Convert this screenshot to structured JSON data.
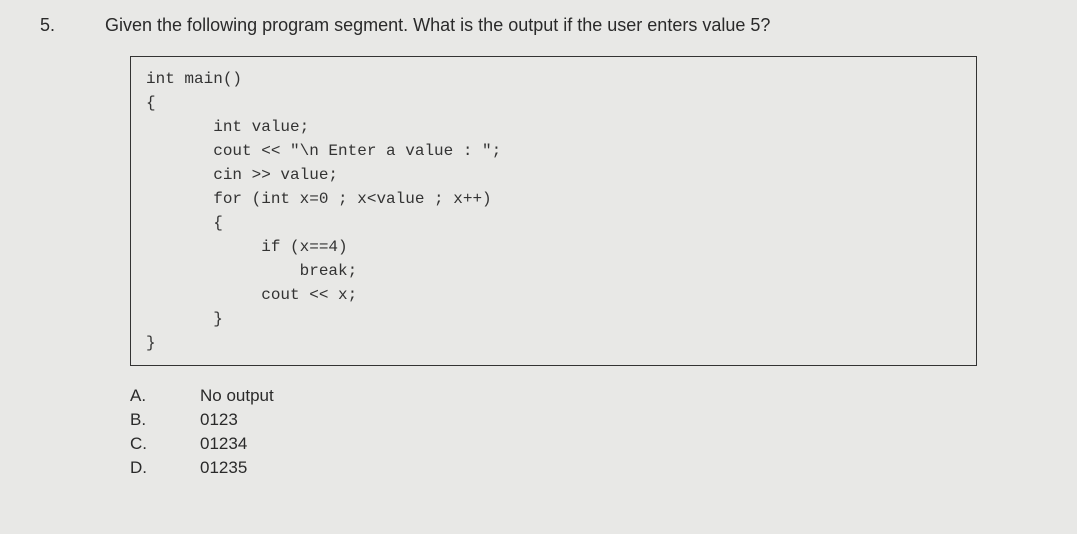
{
  "question": {
    "number": "5.",
    "text": "Given the following program segment. What is the output if the user enters value 5?"
  },
  "code": "int main()\n{\n       int value;\n       cout << \"\\n Enter a value : \";\n       cin >> value;\n       for (int x=0 ; x<value ; x++)\n       {\n            if (x==4)\n                break;\n            cout << x;\n       }\n}",
  "options": [
    {
      "letter": "A.",
      "text": "No output"
    },
    {
      "letter": "B.",
      "text": "0123"
    },
    {
      "letter": "C.",
      "text": "01234"
    },
    {
      "letter": "D.",
      "text": "01235"
    }
  ]
}
